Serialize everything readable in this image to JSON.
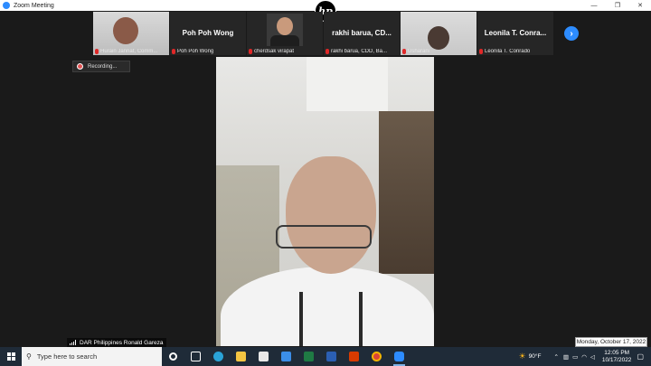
{
  "window": {
    "title": "Zoom Meeting",
    "minimize": "—",
    "restore": "❐",
    "close": "✕"
  },
  "gallery": {
    "tiles": [
      {
        "caption": "Hurain Jannat, Comm...",
        "big_name": ""
      },
      {
        "caption": "Poh Poh Wong",
        "big_name": "Poh Poh Wong"
      },
      {
        "caption": "cherdsak virapat",
        "big_name": ""
      },
      {
        "caption": "rakhi barua, CDD, Ba...",
        "big_name": "rakhi barua, CD..."
      },
      {
        "caption": "Usharani",
        "big_name": ""
      },
      {
        "caption": "Leonila T. Conrado",
        "big_name": "Leonila T. Conra..."
      }
    ],
    "next_arrow": "›"
  },
  "hp_logo": "hp",
  "recording": {
    "label": "Recording..."
  },
  "main_speaker": {
    "name": "DAR Philippines Ronald Gareza"
  },
  "date_tooltip": "Monday, October 17, 2022",
  "taskbar": {
    "search_placeholder": "Type here to search",
    "weather": "90°F",
    "time": "12:05 PM",
    "date": "10/17/2022",
    "apps": [
      "task-view",
      "edge",
      "file-explorer",
      "store",
      "mail",
      "excel",
      "word",
      "office",
      "chrome",
      "zoom"
    ]
  },
  "colors": {
    "accent": "#2d8cff",
    "taskbar": "#1f2b38",
    "mic_muted": "#e02828"
  }
}
